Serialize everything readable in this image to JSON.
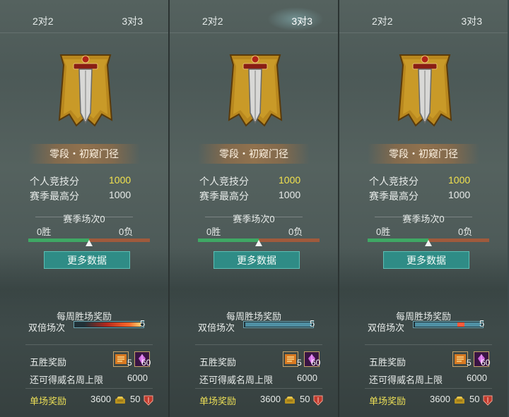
{
  "panels": [
    {
      "tabs": {
        "left": "2对2",
        "right": "3对3",
        "active": "none"
      },
      "rank": "零段・初窥门径",
      "personal_score_label": "个人竞技分",
      "personal_score": "1000",
      "season_best_label": "赛季最高分",
      "season_best": "1000",
      "season_matches": "赛季场次0",
      "wins": "0胜",
      "losses": "0负",
      "win_ratio": 0.5,
      "more_data": "更多数据",
      "weekly_reward": "每周胜场奖励",
      "double_label": "双倍场次",
      "double_count": "5",
      "double_style": "fire",
      "five_win_label": "五胜奖励",
      "five_win_icon1_num": "5",
      "five_win_icon2_num": "60",
      "remaining_label": "还可得威名周上限",
      "remaining_value": "6000",
      "single_label": "单场奖励",
      "single_gold": "3600",
      "single_honor": "50"
    },
    {
      "tabs": {
        "left": "2对2",
        "right": "3对3",
        "active": "right"
      },
      "rank": "零段・初窥门径",
      "personal_score_label": "个人竞技分",
      "personal_score": "1000",
      "season_best_label": "赛季最高分",
      "season_best": "1000",
      "season_matches": "赛季场次0",
      "wins": "0胜",
      "losses": "0负",
      "win_ratio": 0.5,
      "more_data": "更多数据",
      "weekly_reward": "每周胜场奖励",
      "double_label": "双倍场次",
      "double_count": "5",
      "double_style": "blue",
      "five_win_label": "五胜奖励",
      "five_win_icon1_num": "5",
      "five_win_icon2_num": "60",
      "remaining_label": "还可得威名周上限",
      "remaining_value": "6000",
      "single_label": "单场奖励",
      "single_gold": "3600",
      "single_honor": "50"
    },
    {
      "tabs": {
        "left": "2对2",
        "right": "3对3",
        "active": "none"
      },
      "rank": "零段・初窥门径",
      "personal_score_label": "个人竞技分",
      "personal_score": "1000",
      "season_best_label": "赛季最高分",
      "season_best": "1000",
      "season_matches": "赛季场次0",
      "wins": "0胜",
      "losses": "0负",
      "win_ratio": 0.5,
      "more_data": "更多数据",
      "weekly_reward": "每周胜场奖励",
      "double_label": "双倍场次",
      "double_count": "5",
      "double_style": "blue-spark",
      "five_win_label": "五胜奖励",
      "five_win_icon1_num": "5",
      "five_win_icon2_num": "60",
      "remaining_label": "还可得威名周上限",
      "remaining_value": "6000",
      "single_label": "单场奖励",
      "single_gold": "3600",
      "single_honor": "50"
    }
  ],
  "icons": [
    "sword-banner-icon",
    "scroll-icon",
    "gem-icon",
    "gold-ingot-icon",
    "shield-icon"
  ],
  "colors": {
    "score_highlight": "#f2e24e",
    "single_reward_label": "#ecdf56",
    "button": "#2f8c86",
    "win_bar": "#3fa864",
    "loss_bar": "#a05a3c"
  }
}
